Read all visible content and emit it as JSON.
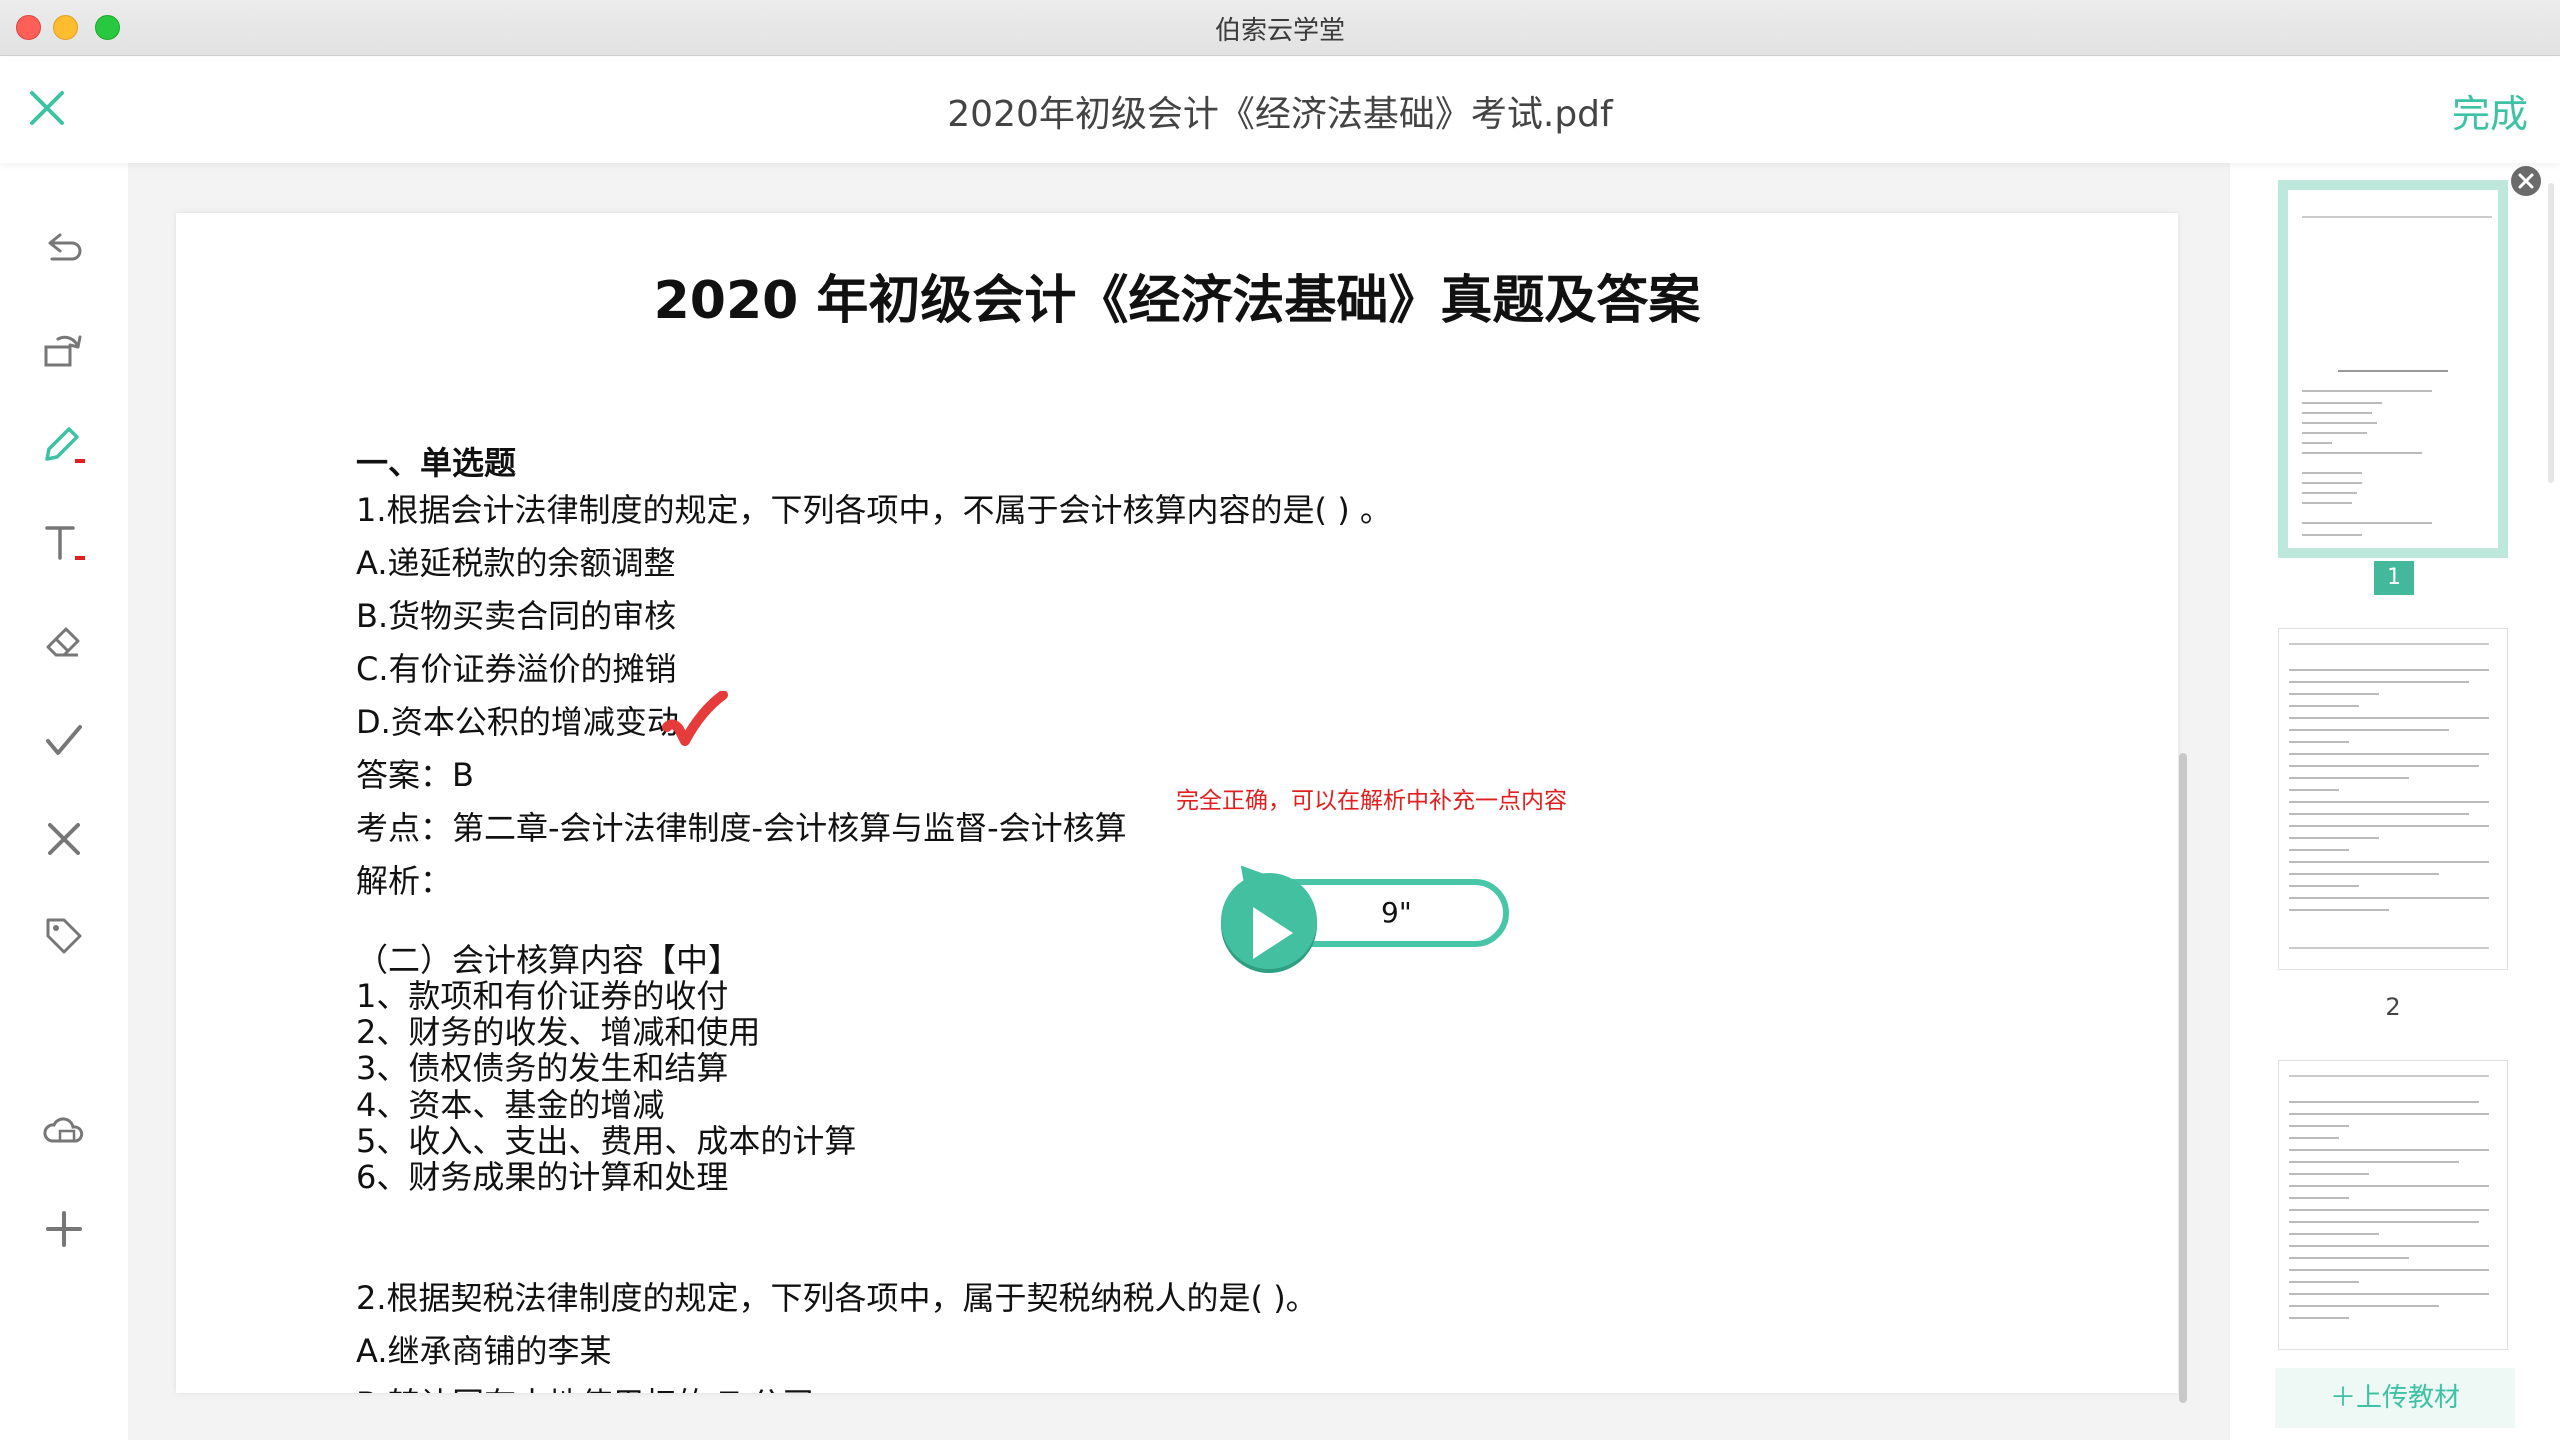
{
  "app": {
    "title": "伯索云学堂"
  },
  "header": {
    "doc_title": "2020年初级会计《经济法基础》考试.pdf",
    "done_label": "完成"
  },
  "toolbar": {
    "tools": [
      "undo-icon",
      "rotate-icon",
      "pen-icon",
      "text-icon",
      "eraser-icon",
      "check-icon",
      "cross-icon",
      "tag-icon",
      "cloud-icon",
      "plus-icon"
    ],
    "accent": "#3ec2a4",
    "indicator": "#e02020"
  },
  "document": {
    "title": "2020 年初级会计《经济法基础》真题及答案",
    "section": "一、单选题",
    "q1": {
      "question": "1.根据会计法律制度的规定，下列各项中，不属于会计核算内容的是( ) 。",
      "options": [
        "A.递延税款的余额调整",
        "B.货物买卖合同的审核",
        "C.有价证券溢价的摊销",
        "D.资本公积的增减变动"
      ],
      "answer": "答案：B",
      "point": "考点：第二章-会计法律制度-会计核算与监督-会计核算",
      "analysis": "解析：",
      "sub_heading": "（二）会计核算内容【中】",
      "items": [
        "1、款项和有价证券的收付",
        "2、财务的收发、增减和使用",
        "3、债权债务的发生和结算",
        "4、资本、基金的增减",
        "5、收入、支出、费用、成本的计算",
        "6、财务成果的计算和处理"
      ]
    },
    "q2": {
      "question": "2.根据契税法律制度的规定，下列各项中，属于契税纳税人的是( )。",
      "options": [
        "A.继承商铺的李某",
        "B.转让国有土地使用权的 Z 公司"
      ]
    },
    "comment": "完全正确，可以在解析中补充一点内容",
    "audio": {
      "duration": "9\""
    }
  },
  "thumbnails": {
    "pages": [
      "1",
      "2"
    ],
    "upload_label": "＋上传教材"
  }
}
